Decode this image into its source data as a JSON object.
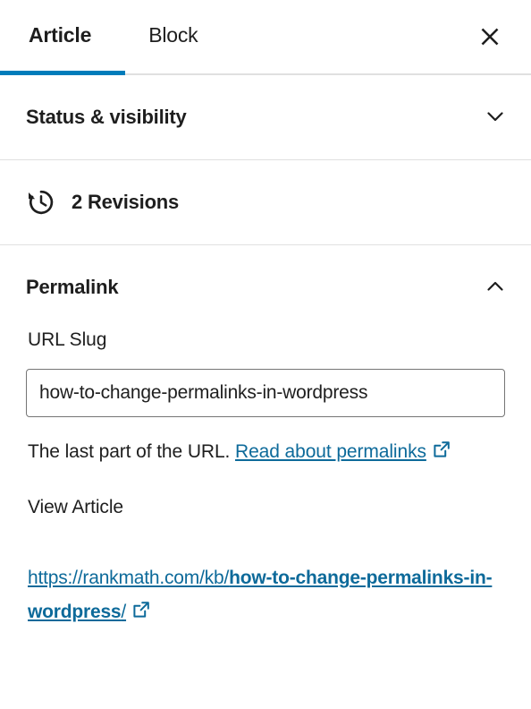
{
  "colors": {
    "accent": "#007cba",
    "link": "#0d6a9a",
    "text": "#1e1e1e",
    "border": "#e0e0e0",
    "input_border": "#757575"
  },
  "tabs": [
    {
      "label": "Article",
      "active": true
    },
    {
      "label": "Block",
      "active": false
    }
  ],
  "close_button": {
    "icon": "close-icon",
    "label": "×"
  },
  "panels": {
    "status_visibility": {
      "title": "Status & visibility",
      "expanded": false,
      "chevron": "chevron-down-icon"
    },
    "revisions": {
      "label": "2 Revisions",
      "count": 2,
      "icon": "backup-clock-icon"
    },
    "permalink": {
      "title": "Permalink",
      "expanded": true,
      "chevron": "chevron-up-icon",
      "url_slug_label": "URL Slug",
      "url_slug_value": "how-to-change-permalinks-in-wordpress",
      "url_slug_placeholder": "how-to-change-permalinks-in-wordpress",
      "help_prefix": "The last part of the URL. ",
      "help_link_text": "Read about permalinks",
      "help_link_icon": "external-link-icon",
      "view_article_label": "View Article",
      "view_url": {
        "base": "https://rankmath.com/kb/",
        "slug": "how-to-change-permalinks-in-wordpress",
        "tail": "/",
        "icon": "external-link-icon"
      }
    }
  }
}
